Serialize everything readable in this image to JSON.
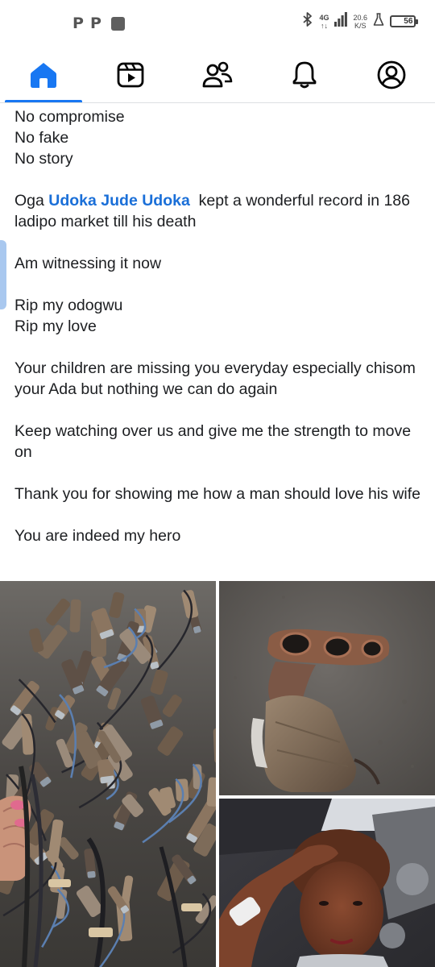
{
  "status_bar": {
    "left_icons": [
      "p-notification-icon",
      "p-notification-icon",
      "square-notification-icon"
    ],
    "p1": "P",
    "p2": "P",
    "network": "4G",
    "network_sub": "↑↓",
    "speed_value": "20.6",
    "speed_unit": "K/S",
    "battery": "56"
  },
  "nav": {
    "items": [
      {
        "name": "home",
        "icon": "home-icon",
        "active": true
      },
      {
        "name": "video",
        "icon": "video-icon",
        "active": false
      },
      {
        "name": "friends",
        "icon": "friends-icon",
        "active": false
      },
      {
        "name": "notifications",
        "icon": "bell-icon",
        "active": false
      },
      {
        "name": "profile",
        "icon": "profile-icon",
        "active": false
      }
    ],
    "accent": "#1877f2"
  },
  "post": {
    "line1": "No compromise",
    "line2": "No fake",
    "line3": "No story",
    "p2_prefix": "Oga ",
    "p2_mention": "Udoka Jude Udoka",
    "p2_suffix": "  kept a wonderful record in 186 ladipo market till his death",
    "p3": "Am witnessing it now",
    "p4_line1": "Rip my odogwu",
    "p4_line2": "Rip my love",
    "p5": "Your children are missing you everyday especially chisom your Ada but nothing we can do again",
    "p6": "Keep watching over us and give me the strength to move on",
    "p7": "Thank you for showing me how a man should love his wife",
    "p8": "You are indeed my hero",
    "mention_color": "#1a6fd8"
  },
  "photos": [
    {
      "name": "sensors-pile-photo"
    },
    {
      "name": "exhaust-manifest-photo"
    },
    {
      "name": "woman-salute-photo"
    }
  ]
}
